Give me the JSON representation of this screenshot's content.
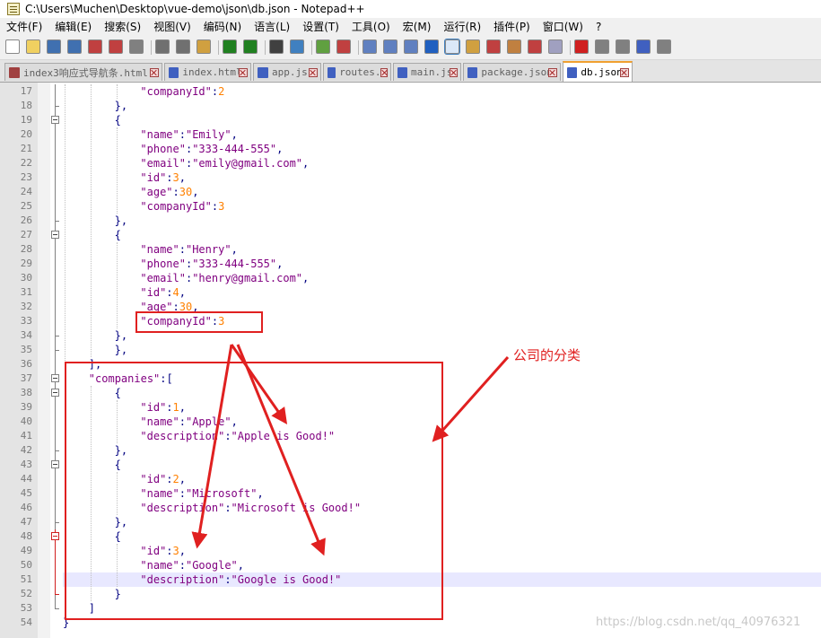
{
  "window": {
    "title": "C:\\Users\\Muchen\\Desktop\\vue-demo\\json\\db.json - Notepad++"
  },
  "menu": [
    {
      "label": "文件(F)"
    },
    {
      "label": "编辑(E)"
    },
    {
      "label": "搜索(S)"
    },
    {
      "label": "视图(V)"
    },
    {
      "label": "编码(N)"
    },
    {
      "label": "语言(L)"
    },
    {
      "label": "设置(T)"
    },
    {
      "label": "工具(O)"
    },
    {
      "label": "宏(M)"
    },
    {
      "label": "运行(R)"
    },
    {
      "label": "插件(P)"
    },
    {
      "label": "窗口(W)"
    },
    {
      "label": "?"
    }
  ],
  "toolbar_icons": [
    "new-file-icon",
    "open-file-icon",
    "save-icon",
    "save-all-icon",
    "close-icon",
    "close-all-icon",
    "print-icon",
    "cut-icon",
    "copy-icon",
    "paste-icon",
    "undo-icon",
    "redo-icon",
    "find-icon",
    "replace-icon",
    "zoom-in-icon",
    "zoom-out-icon",
    "sync-vertical-icon",
    "sync-horizontal-icon",
    "word-wrap-icon",
    "show-all-chars-icon",
    "indent-guide-icon",
    "doc-map-icon",
    "function-list-icon",
    "folder-workspace-icon",
    "doc-switcher-icon",
    "monitoring-icon",
    "record-macro-icon",
    "stop-macro-icon",
    "play-macro-icon",
    "run-macro-multiple-icon",
    "save-macro-icon"
  ],
  "tabs": [
    {
      "label": "index3响应式导航条.html",
      "color": "#a04040",
      "active": false
    },
    {
      "label": "index.html",
      "color": "#4060c0",
      "active": false
    },
    {
      "label": "app.js",
      "color": "#4060c0",
      "active": false
    },
    {
      "label": "routes.js",
      "color": "#4060c0",
      "active": false
    },
    {
      "label": "main.js",
      "color": "#4060c0",
      "active": false
    },
    {
      "label": "package.json",
      "color": "#4060c0",
      "active": false
    },
    {
      "label": "db.json",
      "color": "#4060c0",
      "active": true
    }
  ],
  "code_lines": [
    {
      "n": "17",
      "indent": 12,
      "parts": [
        [
          "k",
          "\"companyId\""
        ],
        [
          "p",
          ":"
        ],
        [
          "n",
          "2"
        ]
      ]
    },
    {
      "n": "18",
      "indent": 8,
      "parts": [
        [
          "p",
          "},"
        ]
      ]
    },
    {
      "n": "19",
      "indent": 8,
      "parts": [
        [
          "p",
          "{"
        ]
      ]
    },
    {
      "n": "20",
      "indent": 12,
      "parts": [
        [
          "k",
          "\"name\""
        ],
        [
          "p",
          ":"
        ],
        [
          "s",
          "\"Emily\""
        ],
        [
          "p",
          ","
        ]
      ]
    },
    {
      "n": "21",
      "indent": 12,
      "parts": [
        [
          "k",
          "\"phone\""
        ],
        [
          "p",
          ":"
        ],
        [
          "s",
          "\"333-444-555\""
        ],
        [
          "p",
          ","
        ]
      ]
    },
    {
      "n": "22",
      "indent": 12,
      "parts": [
        [
          "k",
          "\"email\""
        ],
        [
          "p",
          ":"
        ],
        [
          "s",
          "\"emily@gmail.com\""
        ],
        [
          "p",
          ","
        ]
      ]
    },
    {
      "n": "23",
      "indent": 12,
      "parts": [
        [
          "k",
          "\"id\""
        ],
        [
          "p",
          ":"
        ],
        [
          "n",
          "3"
        ],
        [
          "p",
          ","
        ]
      ]
    },
    {
      "n": "24",
      "indent": 12,
      "parts": [
        [
          "k",
          "\"age\""
        ],
        [
          "p",
          ":"
        ],
        [
          "n",
          "30"
        ],
        [
          "p",
          ","
        ]
      ]
    },
    {
      "n": "25",
      "indent": 12,
      "parts": [
        [
          "k",
          "\"companyId\""
        ],
        [
          "p",
          ":"
        ],
        [
          "n",
          "3"
        ]
      ]
    },
    {
      "n": "26",
      "indent": 8,
      "parts": [
        [
          "p",
          "},"
        ]
      ]
    },
    {
      "n": "27",
      "indent": 8,
      "parts": [
        [
          "p",
          "{"
        ]
      ]
    },
    {
      "n": "28",
      "indent": 12,
      "parts": [
        [
          "k",
          "\"name\""
        ],
        [
          "p",
          ":"
        ],
        [
          "s",
          "\"Henry\""
        ],
        [
          "p",
          ","
        ]
      ]
    },
    {
      "n": "29",
      "indent": 12,
      "parts": [
        [
          "k",
          "\"phone\""
        ],
        [
          "p",
          ":"
        ],
        [
          "s",
          "\"333-444-555\""
        ],
        [
          "p",
          ","
        ]
      ]
    },
    {
      "n": "30",
      "indent": 12,
      "parts": [
        [
          "k",
          "\"email\""
        ],
        [
          "p",
          ":"
        ],
        [
          "s",
          "\"henry@gmail.com\""
        ],
        [
          "p",
          ","
        ]
      ]
    },
    {
      "n": "31",
      "indent": 12,
      "parts": [
        [
          "k",
          "\"id\""
        ],
        [
          "p",
          ":"
        ],
        [
          "n",
          "4"
        ],
        [
          "p",
          ","
        ]
      ]
    },
    {
      "n": "32",
      "indent": 12,
      "parts": [
        [
          "k",
          "\"age\""
        ],
        [
          "p",
          ":"
        ],
        [
          "n",
          "30"
        ],
        [
          "p",
          ","
        ]
      ]
    },
    {
      "n": "33",
      "indent": 12,
      "parts": [
        [
          "k",
          "\"companyId\""
        ],
        [
          "p",
          ":"
        ],
        [
          "n",
          "3"
        ]
      ]
    },
    {
      "n": "34",
      "indent": 8,
      "parts": [
        [
          "p",
          "},"
        ]
      ]
    },
    {
      "n": "35",
      "indent": 8,
      "parts": [
        [
          "p",
          "},"
        ]
      ]
    },
    {
      "n": "36",
      "indent": 4,
      "parts": [
        [
          "p",
          "],"
        ]
      ]
    },
    {
      "n": "37",
      "indent": 4,
      "parts": [
        [
          "k",
          "\"companies\""
        ],
        [
          "p",
          ":["
        ]
      ]
    },
    {
      "n": "38",
      "indent": 8,
      "parts": [
        [
          "p",
          "{"
        ]
      ]
    },
    {
      "n": "39",
      "indent": 12,
      "parts": [
        [
          "k",
          "\"id\""
        ],
        [
          "p",
          ":"
        ],
        [
          "n",
          "1"
        ],
        [
          "p",
          ","
        ]
      ]
    },
    {
      "n": "40",
      "indent": 12,
      "parts": [
        [
          "k",
          "\"name\""
        ],
        [
          "p",
          ":"
        ],
        [
          "s",
          "\"Apple\""
        ],
        [
          "p",
          ","
        ]
      ]
    },
    {
      "n": "41",
      "indent": 12,
      "parts": [
        [
          "k",
          "\"description\""
        ],
        [
          "p",
          ":"
        ],
        [
          "s",
          "\"Apple is Good!\""
        ]
      ]
    },
    {
      "n": "42",
      "indent": 8,
      "parts": [
        [
          "p",
          "},"
        ]
      ]
    },
    {
      "n": "43",
      "indent": 8,
      "parts": [
        [
          "p",
          "{"
        ]
      ]
    },
    {
      "n": "44",
      "indent": 12,
      "parts": [
        [
          "k",
          "\"id\""
        ],
        [
          "p",
          ":"
        ],
        [
          "n",
          "2"
        ],
        [
          "p",
          ","
        ]
      ]
    },
    {
      "n": "45",
      "indent": 12,
      "parts": [
        [
          "k",
          "\"name\""
        ],
        [
          "p",
          ":"
        ],
        [
          "s",
          "\"Microsoft\""
        ],
        [
          "p",
          ","
        ]
      ]
    },
    {
      "n": "46",
      "indent": 12,
      "parts": [
        [
          "k",
          "\"description\""
        ],
        [
          "p",
          ":"
        ],
        [
          "s",
          "\"Microsoft is Good!\""
        ]
      ]
    },
    {
      "n": "47",
      "indent": 8,
      "parts": [
        [
          "p",
          "},"
        ]
      ]
    },
    {
      "n": "48",
      "indent": 8,
      "parts": [
        [
          "p",
          "{"
        ]
      ]
    },
    {
      "n": "49",
      "indent": 12,
      "parts": [
        [
          "k",
          "\"id\""
        ],
        [
          "p",
          ":"
        ],
        [
          "n",
          "3"
        ],
        [
          "p",
          ","
        ]
      ]
    },
    {
      "n": "50",
      "indent": 12,
      "parts": [
        [
          "k",
          "\"name\""
        ],
        [
          "p",
          ":"
        ],
        [
          "s",
          "\"Google\""
        ],
        [
          "p",
          ","
        ]
      ]
    },
    {
      "n": "51",
      "indent": 12,
      "parts": [
        [
          "k",
          "\"description\""
        ],
        [
          "p",
          ":"
        ],
        [
          "s",
          "\"Google is Good!\""
        ]
      ]
    },
    {
      "n": "52",
      "indent": 8,
      "parts": [
        [
          "p",
          "}"
        ]
      ]
    },
    {
      "n": "53",
      "indent": 4,
      "parts": [
        [
          "p",
          "]"
        ]
      ]
    },
    {
      "n": "54",
      "indent": 0,
      "parts": [
        [
          "p",
          "}"
        ]
      ]
    }
  ],
  "current_line": "51",
  "annotation": {
    "label": "公司的分类",
    "color": "#e02020"
  },
  "watermark": "https://blog.csdn.net/qq_40976321",
  "colors": {
    "key": "#800080",
    "string": "#800080",
    "number": "#ff8000",
    "punct": "#000080",
    "accent": "#f0a030"
  }
}
